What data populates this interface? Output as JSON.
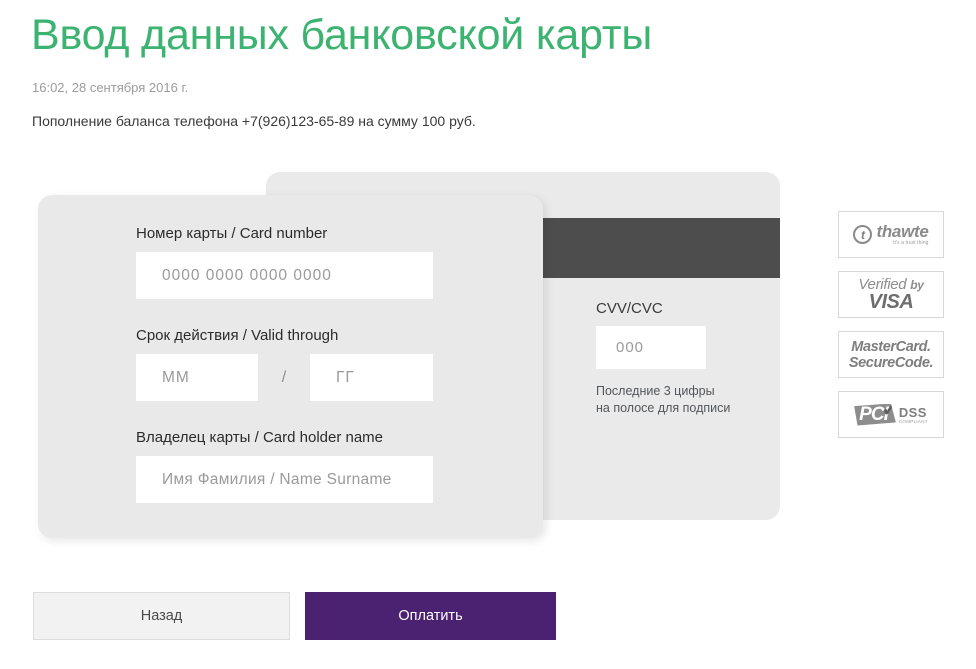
{
  "header": {
    "title": "Ввод данных банковской карты",
    "timestamp": "16:02, 28 сентября 2016 г.",
    "description": "Пополнение баланса телефона +7(926)123-65-89 на сумму 100 руб.",
    "title_color": "#3cb371"
  },
  "form": {
    "card_number": {
      "label": "Номер карты / Card number",
      "placeholder": "0000  0000  0000  0000",
      "value": ""
    },
    "valid_through": {
      "label": "Срок действия / Valid through",
      "month_placeholder": "ММ",
      "month_value": "",
      "separator": "/",
      "year_placeholder": "ГГ",
      "year_value": ""
    },
    "holder": {
      "label": "Владелец карты / Card holder name",
      "placeholder": "Имя Фамилия / Name Surname",
      "value": ""
    }
  },
  "cvv": {
    "label": "CVV/CVC",
    "placeholder": "000",
    "value": "",
    "hint_line1": "Последние 3 цифры",
    "hint_line2": "на полосе для подписи"
  },
  "badges": [
    {
      "name": "thawte",
      "mark": "t",
      "word": "thawte",
      "tagline": "it's a trust thing"
    },
    {
      "name": "verified-by-visa",
      "line1_a": "Verified",
      "line1_b": "by",
      "line2": "VISA"
    },
    {
      "name": "mastercard-securecode",
      "line1": "MasterCard.",
      "line2": "SecureCode."
    },
    {
      "name": "pci-dss",
      "block": "PCI",
      "dss": "DSS",
      "compliant": "COMPLIANT"
    }
  ],
  "buttons": {
    "back_label": "Назад",
    "pay_label": "Оплатить",
    "pay_color": "#4b2172",
    "back_color": "#f2f2f2"
  }
}
